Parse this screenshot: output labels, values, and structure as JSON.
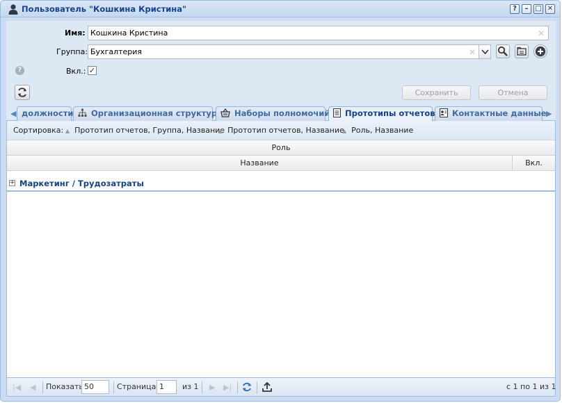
{
  "window": {
    "title": "Пользователь \"Кошкина Кристина\"",
    "tools": [
      "?",
      "–",
      "□",
      "✕"
    ]
  },
  "form": {
    "name_label": "Имя:",
    "name_value": "Кошкина Кристина",
    "group_label": "Группа:",
    "group_value": "Бухгалтерия",
    "enabled_label": "Вкл.:",
    "enabled_checked": "✓",
    "save_label": "Сохранить",
    "cancel_label": "Отмена"
  },
  "tabs": [
    {
      "label": "должности"
    },
    {
      "label": "Организационная структура"
    },
    {
      "label": "Наборы полномочий"
    },
    {
      "label": "Прототипы отчетов"
    },
    {
      "label": "Контактные данные"
    }
  ],
  "sort": {
    "label": "Сортировка:",
    "options": [
      "Прототип отчетов, Группа, Название",
      "Прототип отчетов, Название",
      "Роль, Название"
    ]
  },
  "grid": {
    "group_header": "Роль",
    "col_name": "Название",
    "col_enabled": "Вкл.",
    "group_row": "Маркетинг / Трудозатраты",
    "expander": "+"
  },
  "pager": {
    "show_label": "Показать",
    "page_size": "50",
    "page_label": "Страница",
    "page_value": "1",
    "of_label": "из 1",
    "summary": "с 1 по 1 из 1"
  },
  "colors": {
    "accent": "#15428b",
    "border": "#99bbe8",
    "background": "#dde8f5"
  }
}
